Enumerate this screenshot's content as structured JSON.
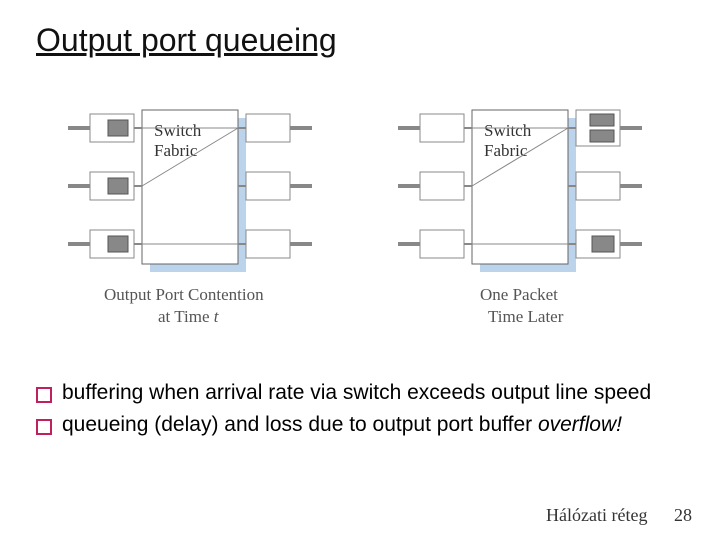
{
  "title": "Output port queueing",
  "diagram": {
    "left_caption_l1": "Output Port Contention",
    "left_caption_l2": "at Time ",
    "left_caption_l2_ital": "t",
    "right_caption_l1": "One Packet",
    "right_caption_l2": "Time Later",
    "switch_fabric_l1": "Switch",
    "switch_fabric_l2": "Fabric"
  },
  "bullets": [
    {
      "text": "buffering when arrival rate via switch exceeds output line speed",
      "italic_trail": ""
    },
    {
      "text": "queueing (delay) and loss due to output port buffer ",
      "italic_trail": "overflow!"
    }
  ],
  "footer": {
    "label": "Hálózati réteg",
    "page": "28"
  }
}
